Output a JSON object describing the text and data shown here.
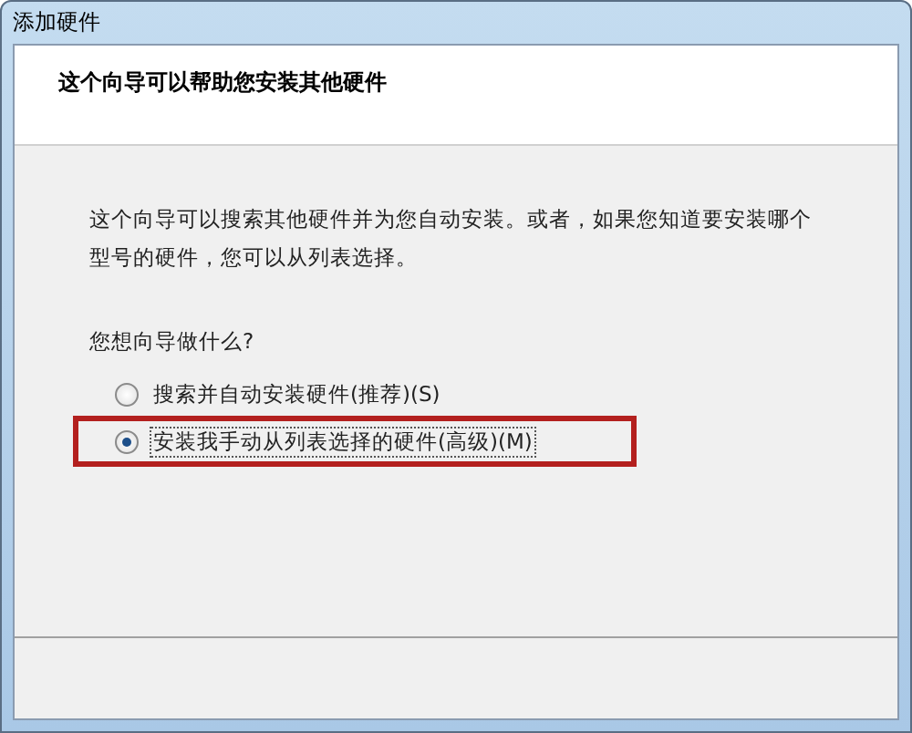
{
  "window": {
    "title": "添加硬件"
  },
  "header": {
    "heading": "这个向导可以帮助您安装其他硬件"
  },
  "body": {
    "description": "这个向导可以搜索其他硬件并为您自动安装。或者，如果您知道要安装哪个型号的硬件，您可以从列表选择。",
    "question": "您想向导做什么?",
    "options": [
      {
        "label": "搜索并自动安装硬件(推荐)(S)",
        "selected": false,
        "highlighted": false
      },
      {
        "label": "安装我手动从列表选择的硬件(高级)(M)",
        "selected": true,
        "highlighted": true
      }
    ]
  }
}
